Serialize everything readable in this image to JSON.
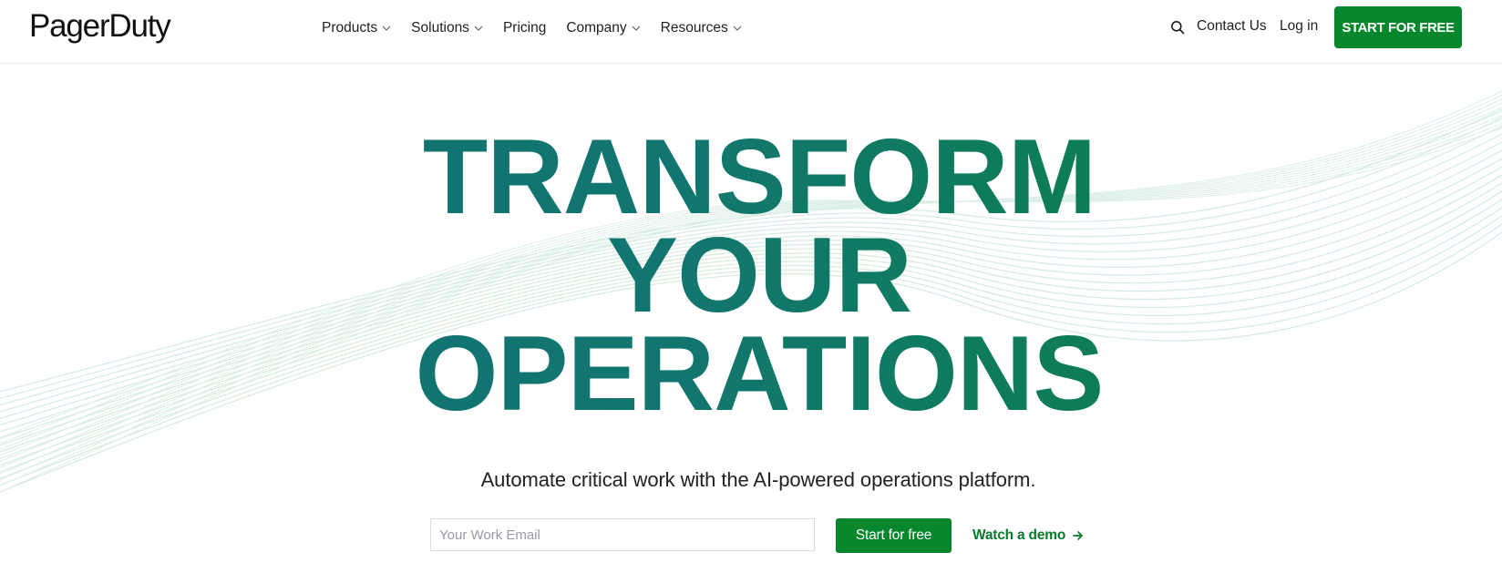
{
  "header": {
    "logo": "PagerDuty",
    "nav": [
      {
        "label": "Products",
        "has_dropdown": true
      },
      {
        "label": "Solutions",
        "has_dropdown": true
      },
      {
        "label": "Pricing",
        "has_dropdown": false
      },
      {
        "label": "Company",
        "has_dropdown": true
      },
      {
        "label": "Resources",
        "has_dropdown": true
      }
    ],
    "search_icon": "search-icon",
    "contact_label": "Contact Us",
    "login_label": "Log in",
    "cta_label": "START FOR FREE"
  },
  "hero": {
    "headline_lines": [
      "TRANSFORM",
      "YOUR",
      "OPERATIONS"
    ],
    "subtitle": "Automate critical work with the AI-powered operations platform.",
    "email_placeholder": "Your Work Email",
    "email_value": "",
    "start_label": "Start for free",
    "demo_label": "Watch a demo",
    "demo_icon": "arrow-right-icon"
  },
  "colors": {
    "brand_green": "#06872b",
    "headline_teal": "#137070",
    "headline_green": "#07892b",
    "link_green": "#0b7a2c",
    "wave_line": "#cfe9dc"
  }
}
